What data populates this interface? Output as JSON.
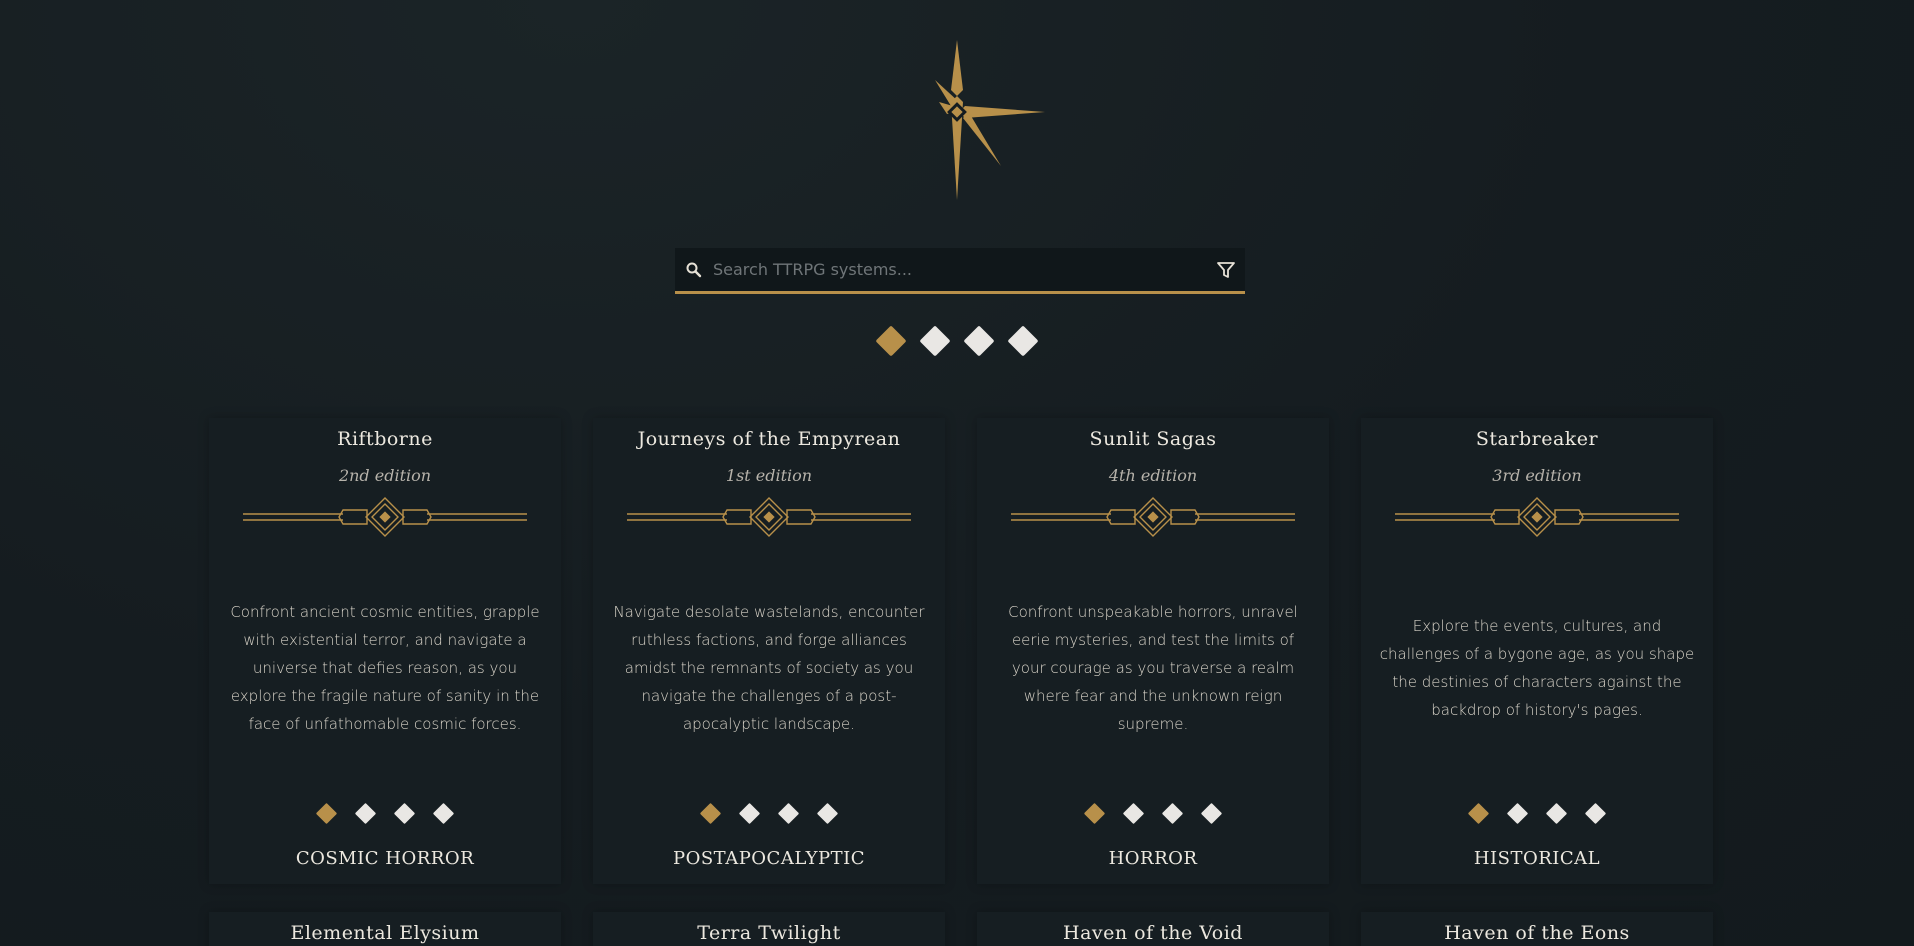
{
  "search": {
    "placeholder": "Search TTRPG systems..."
  },
  "pagination": {
    "pages": 4,
    "active": 0
  },
  "colors": {
    "accent": "#b8904a",
    "background": "#151c20",
    "card": "#161e22",
    "inactive_dot": "#e9e7e4"
  },
  "icons": {
    "logo": "compass-star-icon",
    "search": "search-icon",
    "filter": "filter-icon",
    "ornament": "art-deco-divider-icon"
  },
  "cards": [
    {
      "title": "Riftborne",
      "edition": "2nd edition",
      "description": "Confront ancient cosmic entities, grapple with existential terror, and navigate a universe that defies reason, as you explore the fragile nature of sanity in the face of unfathomable cosmic forces.",
      "genre": "COSMIC HORROR"
    },
    {
      "title": "Journeys of the Empyrean",
      "edition": "1st edition",
      "description": "Navigate desolate wastelands, encounter ruthless factions, and forge alliances amidst the remnants of society as you navigate the challenges of a post-apocalyptic landscape.",
      "genre": "POSTAPOCALYPTIC"
    },
    {
      "title": "Sunlit Sagas",
      "edition": "4th edition",
      "description": "Confront unspeakable horrors, unravel eerie mysteries, and test the limits of your courage as you traverse a realm where fear and the unknown reign supreme.",
      "genre": "HORROR"
    },
    {
      "title": "Starbreaker",
      "edition": "3rd edition",
      "description": "Explore the events, cultures, and challenges of a bygone age, as you shape the destinies of characters against the backdrop of history's pages.",
      "genre": "HISTORICAL"
    }
  ],
  "next_cards": [
    {
      "title": "Elemental Elysium"
    },
    {
      "title": "Terra Twilight"
    },
    {
      "title": "Haven of the Void"
    },
    {
      "title": "Haven of the Eons"
    }
  ]
}
